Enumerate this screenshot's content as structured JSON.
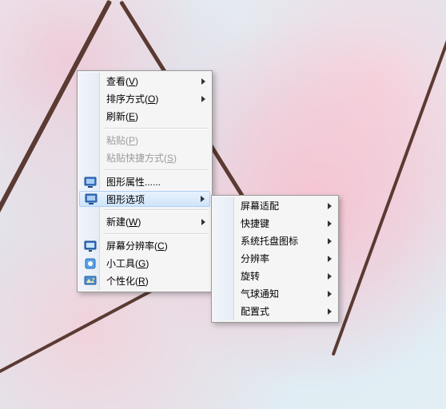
{
  "context_menu": {
    "items": [
      {
        "label": "查看",
        "hotkey": "V",
        "has_submenu": true
      },
      {
        "label": "排序方式",
        "hotkey": "O",
        "has_submenu": true
      },
      {
        "label": "刷新",
        "hotkey": "E"
      }
    ],
    "paste_group": [
      {
        "label": "粘贴",
        "hotkey": "P",
        "disabled": true
      },
      {
        "label": "粘贴快捷方式",
        "hotkey": "S",
        "disabled": true
      }
    ],
    "graphics_group": [
      {
        "label": "图形属性......",
        "icon": "display-icon"
      },
      {
        "label": "图形选项",
        "icon": "display-icon",
        "has_submenu": true,
        "highlighted": true
      }
    ],
    "new_group": [
      {
        "label": "新建",
        "hotkey": "W",
        "has_submenu": true
      }
    ],
    "bottom_group": [
      {
        "label": "屏幕分辨率",
        "hotkey": "C",
        "icon": "resolution-icon"
      },
      {
        "label": "小工具",
        "hotkey": "G",
        "icon": "gadgets-icon"
      },
      {
        "label": "个性化",
        "hotkey": "R",
        "icon": "personalize-icon"
      }
    ]
  },
  "submenu": {
    "items": [
      {
        "label": "屏幕适配",
        "has_submenu": true
      },
      {
        "label": "快捷键",
        "has_submenu": true
      },
      {
        "label": "系统托盘图标",
        "has_submenu": true
      },
      {
        "label": "分辨率",
        "has_submenu": true
      },
      {
        "label": "旋转",
        "has_submenu": true
      },
      {
        "label": "气球通知",
        "has_submenu": true
      },
      {
        "label": "配置式",
        "has_submenu": true
      }
    ]
  }
}
